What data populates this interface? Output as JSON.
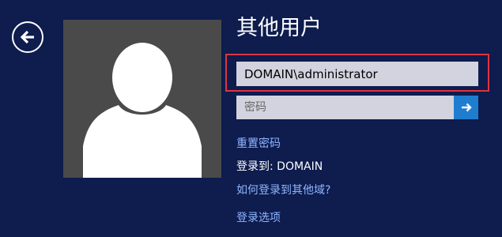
{
  "title": "其他用户",
  "username": {
    "value": "DOMAIN\\administrator"
  },
  "password": {
    "placeholder": "密码"
  },
  "links": {
    "reset_password": "重置密码",
    "other_domain": "如何登录到其他域?",
    "signin_options": "登录选项"
  },
  "signin_to": {
    "label": "登录到:",
    "domain": "DOMAIN"
  },
  "icons": {
    "back": "back-arrow-icon",
    "submit": "right-arrow-icon",
    "avatar": "user-silhouette-icon"
  },
  "colors": {
    "background": "#0e1c4e",
    "highlight": "#e0343f",
    "submit": "#1f7dd0",
    "link": "#8fb6ff"
  }
}
